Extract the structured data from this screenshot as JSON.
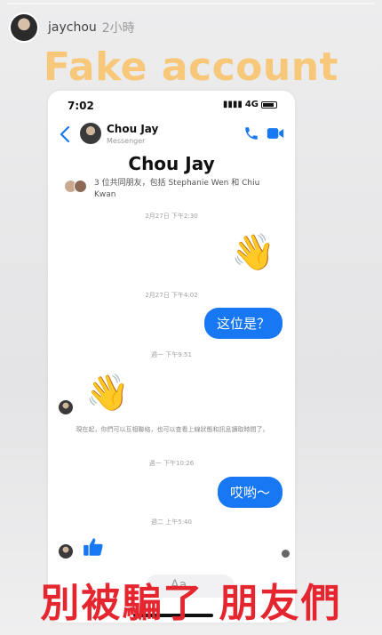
{
  "story": {
    "username": "jaychou",
    "time_ago": "2小時",
    "top_caption": "Fake account",
    "bottom_caption": "別被騙了 朋友們"
  },
  "phone": {
    "status_time": "7:02",
    "network": "4G",
    "header_name": "Chou Jay",
    "header_sub": "Messenger",
    "profile_name": "Chou Jay",
    "mutual_friends": "3 位共同朋友，包括 Stephanie Wen 和 Chiu Kwan",
    "messages": [
      {
        "timestamp": "2月27日 下午2:30",
        "type": "emoji",
        "side": "right",
        "content": "👋"
      },
      {
        "timestamp": "2月27日 下午4:02",
        "type": "text",
        "side": "right",
        "content": "这位是？"
      },
      {
        "timestamp": "週一 下午9:51",
        "type": "emoji",
        "side": "left",
        "content": "👋"
      },
      {
        "timestamp": "週一 下午10:26",
        "type": "text",
        "side": "right",
        "content": "哎哟～"
      },
      {
        "timestamp": "週二 上午5:40",
        "type": "emoji",
        "side": "left",
        "content": "👍"
      }
    ],
    "notice": "現在起，你們可以互相聯絡，也可以查看上線狀態和訊息讀取時間了。",
    "composer_placeholder": "Aa"
  },
  "colors": {
    "messenger_blue": "#1877f2",
    "caption_yellow": "#f7c87a",
    "caption_red": "#e6262f"
  }
}
